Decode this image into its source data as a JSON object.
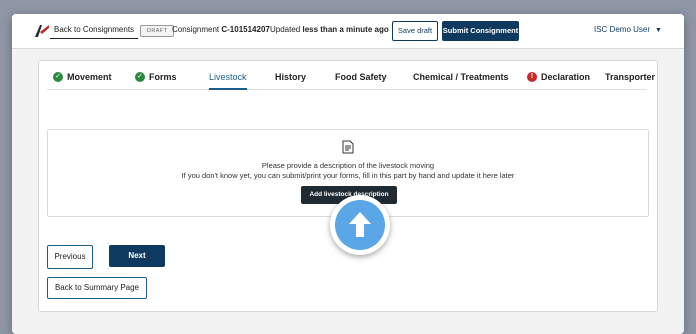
{
  "header": {
    "back_label": "Back to Consignments",
    "draft_badge": "DRAFT",
    "consignment_prefix": "Consignment ",
    "consignment_id": "C-101514207",
    "updated_prefix": "Updated ",
    "updated_value": "less than a minute ago",
    "save_draft_label": "Save draft",
    "submit_label": "Submit Consignment",
    "user_label": "ISC Demo User",
    "user_menu_icon": "chevron-down-icon"
  },
  "tabs": [
    {
      "label": "Movement",
      "status": "complete"
    },
    {
      "label": "Forms",
      "status": "complete"
    },
    {
      "label": "Livestock",
      "status": "active"
    },
    {
      "label": "History",
      "status": "none"
    },
    {
      "label": "Food Safety",
      "status": "none"
    },
    {
      "label": "Chemical / Treatments",
      "status": "none"
    },
    {
      "label": "Declaration",
      "status": "error"
    },
    {
      "label": "Transporter",
      "status": "none"
    }
  ],
  "livestock": {
    "icon": "document-icon",
    "line1": "Please provide a description of the livestock moving",
    "line2": "If you don't know yet, you can submit/print your forms, fill in this part by hand and update it here later",
    "add_button_label": "Add livestock description"
  },
  "nav": {
    "previous_label": "Previous",
    "next_label": "Next",
    "summary_label": "Back to Summary Page"
  },
  "colors": {
    "primary": "#0e3a5f",
    "accent": "#1b5e8c",
    "success": "#2a8a3e",
    "error": "#c62a2a",
    "pointer": "#5aa6e6"
  }
}
